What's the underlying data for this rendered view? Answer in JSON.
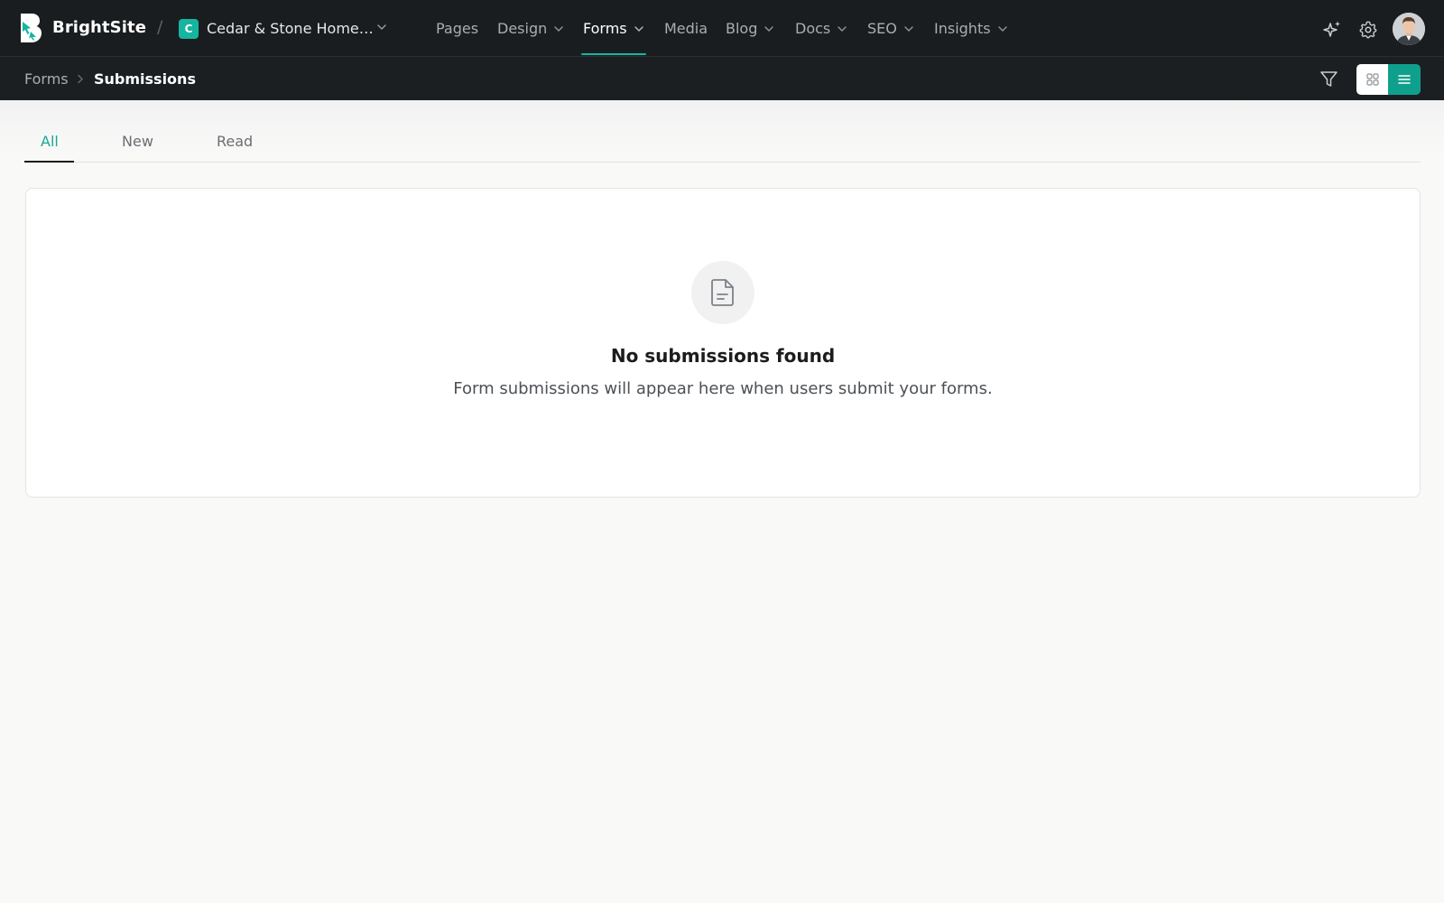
{
  "app": {
    "brand": "BrightSite",
    "separator": "/"
  },
  "site": {
    "badge_letter": "C",
    "name": "Cedar & Stone Home…"
  },
  "nav": {
    "items": [
      {
        "label": "Pages",
        "dropdown": false
      },
      {
        "label": "Design",
        "dropdown": true
      },
      {
        "label": "Forms",
        "dropdown": true,
        "active": true
      },
      {
        "label": "Media",
        "dropdown": false
      },
      {
        "label": "Blog",
        "dropdown": true
      },
      {
        "label": "Docs",
        "dropdown": true
      },
      {
        "label": "SEO",
        "dropdown": true
      },
      {
        "label": "Insights",
        "dropdown": true
      }
    ]
  },
  "header_icons": [
    "sparkle-icon",
    "gear-icon",
    "avatar"
  ],
  "breadcrumb": {
    "root": "Forms",
    "current": "Submissions"
  },
  "toolbar": {
    "icons": [
      "filter-icon",
      "grid-view-icon",
      "list-view-icon"
    ],
    "active_view": "list"
  },
  "tabs": [
    {
      "label": "All",
      "active": true
    },
    {
      "label": "New",
      "active": false
    },
    {
      "label": "Read",
      "active": false
    }
  ],
  "empty_state": {
    "icon": "document-icon",
    "title": "No submissions found",
    "description": "Form submissions will appear here when users submit your forms."
  },
  "colors": {
    "accent": "#16b6a2",
    "topbar": "#1a1d1f",
    "background": "#f9f9f8"
  }
}
